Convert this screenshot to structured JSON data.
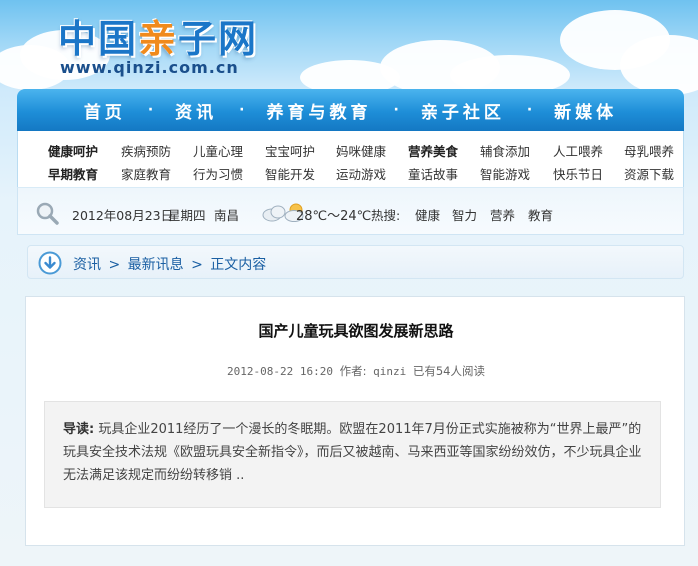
{
  "site": {
    "logo_main": "中国",
    "logo_accent": "亲",
    "logo_tail": "子网",
    "url": "www.qinzi.com.cn"
  },
  "nav": {
    "items": [
      "首页",
      "资讯",
      "养育与教育",
      "亲子社区",
      "新媒体"
    ],
    "separator": "·"
  },
  "categories": {
    "row1": [
      "健康呵护",
      "疾病预防",
      "儿童心理",
      "宝宝呵护",
      "妈咪健康",
      "营养美食",
      "辅食添加",
      "人工喂养",
      "母乳喂养"
    ],
    "row2": [
      "早期教育",
      "家庭教育",
      "行为习惯",
      "智能开发",
      "运动游戏",
      "童话故事",
      "智能游戏",
      "快乐节日",
      "资源下载"
    ]
  },
  "info": {
    "date": "2012年08月23日",
    "weekday": "星期四",
    "city": "南昌",
    "temperature": "28℃～24℃",
    "hot_label": "热搜:",
    "hot_tags": [
      "健康",
      "智力",
      "营养",
      "教育"
    ]
  },
  "breadcrumb": {
    "items": [
      "资讯",
      "最新讯息",
      "正文内容"
    ],
    "separator": ">"
  },
  "article": {
    "title": "国产儿童玩具欲图发展新思路",
    "datetime": "2012-08-22 16:20",
    "author_label": "作者:",
    "author": "qinzi",
    "views": "已有54人阅读",
    "summary_label": "导读:",
    "summary_text": "玩具企业2011经历了一个漫长的冬眠期。欧盟在2011年7月份正式实施被称为“世界上最严”的玩具安全技术法规《欧盟玩具安全新指令》，而后又被越南、马来西亚等国家纷纷效仿，不少玩具企业无法满足该规定而纷纷转移销 .."
  },
  "colors": {
    "nav_blue": "#1e8ed8",
    "logo_blue": "#1b76c8",
    "logo_orange": "#f08a1c",
    "link_blue": "#1a5fa3"
  },
  "icons": {
    "search": "search-icon",
    "weather": "partly-cloudy-icon",
    "breadcrumb": "down-arrow-circle-icon"
  }
}
